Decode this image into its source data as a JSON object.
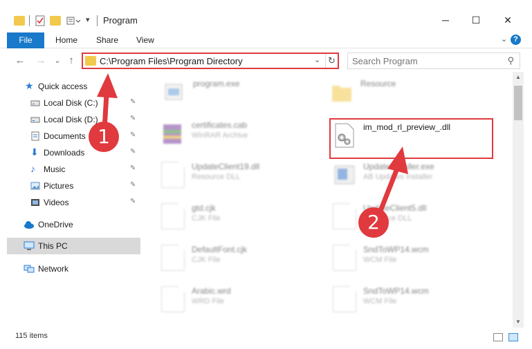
{
  "window": {
    "title": "Program",
    "minimize": "─",
    "maximize": "☐",
    "close": "✕"
  },
  "ribbon": {
    "tabs": [
      "File",
      "Home",
      "Share",
      "View"
    ],
    "expand": "⌄",
    "help": "?"
  },
  "nav": {
    "back": "←",
    "forward": "→",
    "recent": "⌄",
    "up": "↑",
    "address": "C:\\Program Files\\Program Directory",
    "address_dropdown": "⌄",
    "refresh": "↻",
    "search_placeholder": "Search Program",
    "search_icon": "⚲"
  },
  "sidebar": {
    "items": [
      {
        "label": "Quick access",
        "icon": "star-icon",
        "pinned": false
      },
      {
        "label": "Local Disk (C:)",
        "icon": "drive-icon",
        "pinned": true
      },
      {
        "label": "Local Disk (D:)",
        "icon": "drive-icon",
        "pinned": true
      },
      {
        "label": "Documents",
        "icon": "documents-icon",
        "pinned": true
      },
      {
        "label": "Downloads",
        "icon": "download-icon",
        "pinned": true
      },
      {
        "label": "Music",
        "icon": "music-icon",
        "pinned": true
      },
      {
        "label": "Pictures",
        "icon": "pictures-icon",
        "pinned": true
      },
      {
        "label": "Videos",
        "icon": "videos-icon",
        "pinned": true
      },
      {
        "label": "OneDrive",
        "icon": "cloud-icon",
        "pinned": false
      },
      {
        "label": "This PC",
        "icon": "computer-icon",
        "pinned": false
      },
      {
        "label": "Network",
        "icon": "network-icon",
        "pinned": false
      }
    ],
    "pin_glyph": "📌"
  },
  "files": [
    {
      "name": "program.exe",
      "type": ""
    },
    {
      "name": "Resource",
      "type": ""
    },
    {
      "name": "certificates.cab",
      "type": "WinRAR Archive"
    },
    {
      "name": "im_mod_rl_preview_.dll",
      "type": ""
    },
    {
      "name": "UpdateClient19.dll",
      "type": "Resource DLL"
    },
    {
      "name": "UpdateInstaller.exe",
      "type": "AB Updates Installer"
    },
    {
      "name": "gtd.cjk",
      "type": "CJK File"
    },
    {
      "name": "UpdateClient5.dll",
      "type": "Resource DLL"
    },
    {
      "name": "DefaultFont.cjk",
      "type": "CJK File"
    },
    {
      "name": "SndToWP14.wcm",
      "type": "WCM File"
    },
    {
      "name": "Arabic.wrd",
      "type": "WRD File"
    },
    {
      "name": "SndToWP14.wcm",
      "type": "WCM File"
    }
  ],
  "status": {
    "item_count": "115 items"
  },
  "annotations": {
    "step1": "1",
    "step2": "2",
    "color": "#e0393e"
  },
  "colors": {
    "accent": "#1979ca",
    "annotation": "#e0393e",
    "selection": "#cce8ff"
  }
}
